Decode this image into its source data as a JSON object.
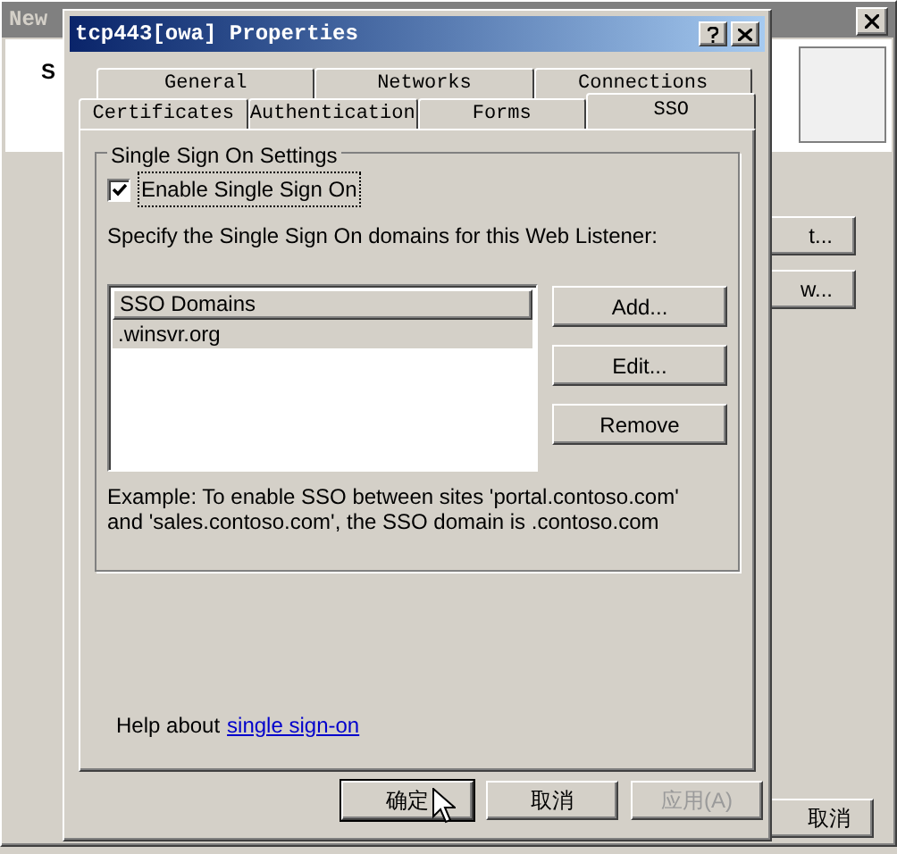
{
  "background_window": {
    "title": "New",
    "heading": "S",
    "buttons": [
      "t...",
      "w..."
    ],
    "cancel_button": "取消"
  },
  "dialog": {
    "title": "tcp443[owa] Properties",
    "tab_rows": [
      [
        {
          "label": "General",
          "selected": false
        },
        {
          "label": "Networks",
          "selected": false
        },
        {
          "label": "Connections",
          "selected": false
        }
      ],
      [
        {
          "label": "Certificates",
          "selected": false
        },
        {
          "label": "Authentication",
          "selected": false
        },
        {
          "label": "Forms",
          "selected": false
        },
        {
          "label": "SSO",
          "selected": true
        }
      ]
    ],
    "group": {
      "title": "Single Sign On Settings",
      "enable_checkbox": {
        "label": "Enable Single Sign On",
        "checked": true
      },
      "instruction": "Specify the Single Sign On domains for this Web Listener:",
      "list": {
        "header": "SSO Domains",
        "items": [
          {
            "label": ".winsvr.org",
            "selected": true
          }
        ]
      },
      "side_buttons": [
        {
          "label": "Add...",
          "disabled": false
        },
        {
          "label": "Edit...",
          "disabled": false
        },
        {
          "label": "Remove",
          "disabled": false
        }
      ],
      "example": "Example: To enable SSO between sites 'portal.contoso.com' and 'sales.contoso.com', the SSO domain is .contoso.com"
    },
    "help": {
      "text": "Help about",
      "link": "single sign-on"
    },
    "buttons": [
      {
        "label": "确定",
        "disabled": false
      },
      {
        "label": "取消",
        "disabled": false
      },
      {
        "label": "应用(A)",
        "disabled": true
      }
    ]
  }
}
